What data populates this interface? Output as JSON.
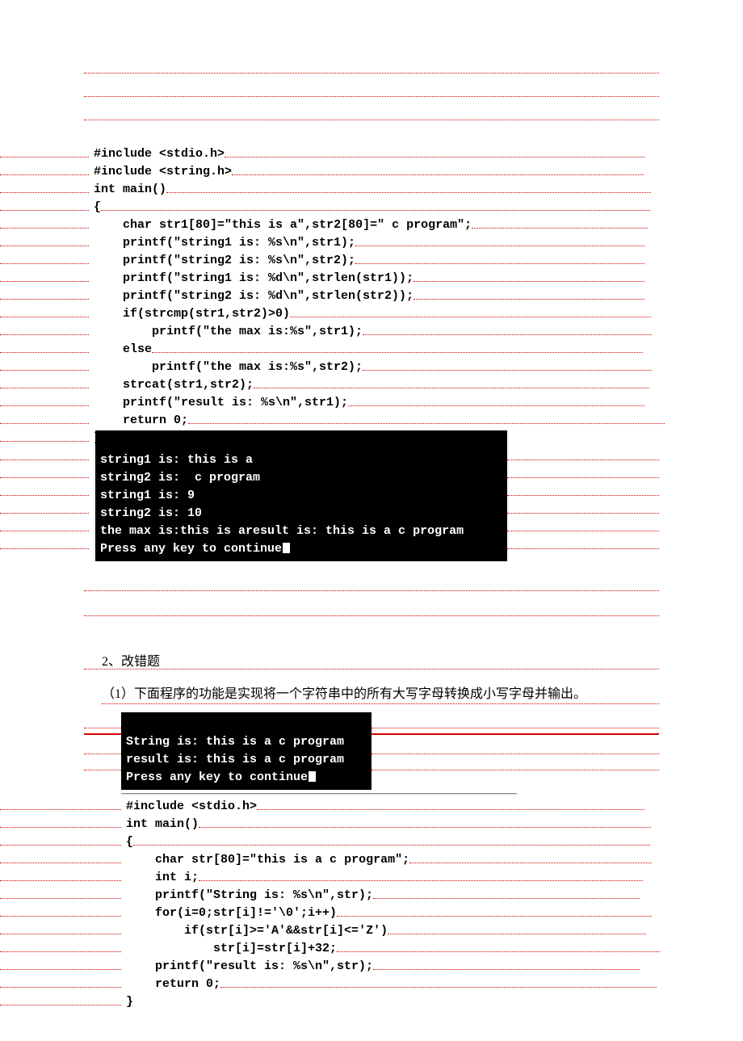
{
  "code1": {
    "la": "#include",
    "lb": "<stdio.h>",
    "lc": "#include",
    "ld": "<string.h>",
    "le": "int",
    "lf": " main()",
    "lg": "{",
    "lh": "char",
    "li": " str1[80]=\"this is a\",str2[80]=\" c program\";",
    "lj": "    printf(\"string1 is: %s\\n\",str1);",
    "lk": "    printf(\"string2 is: %s\\n\",str2);",
    "ll": "    printf(\"string1 is: %d\\n\",strlen(str1));",
    "lm": "    printf(\"string2 is: %d\\n\",strlen(str2));",
    "ln": "if",
    "lo": "(strcmp(str1,str2)>0)",
    "lp": "        printf(\"the max is:%s\",str1);",
    "lq": "else",
    "lr": "        printf(\"the max is:%s\",str2);",
    "ls": "    strcat(str1,str2);",
    "lt": "    printf(\"result is: %s\\n\",str1);",
    "lu": "return",
    "lv": " 0;",
    "lw": "}"
  },
  "console1": {
    "l1": "string1 is: this is a",
    "l2": "string2 is:  c program",
    "l3": "string1 is: 9",
    "l4": "string2 is: 10",
    "l5": "the max is:this is aresult is: this is a c program",
    "l6": "Press any key to continue"
  },
  "section2": {
    "heading": "2、改错题",
    "q1": "（1）下面程序的功能是实现将一个字符串中的所有大写字母转换成小写字母并输出。"
  },
  "console2": {
    "l1": "String is: this is a c program",
    "l2": "result is: this is a c program",
    "l3": "Press any key to continue"
  },
  "code2": {
    "la": "#include",
    "lb": "<stdio.h>",
    "lc": "int",
    "ld": " main()",
    "le": "{",
    "lf": "char",
    "lg": " str[80]=\"this is a c program\";",
    "lh": "int",
    "li": " i;",
    "lj": "    printf(\"String is: %s\\n\",str);",
    "lk": "for",
    "ll": "(i=0;str[i]!='\\0';i++)",
    "lm": "if",
    "ln": "(str[i]>='A'&&str[i]<='Z')",
    "lo": "            str[i]=str[i]+32;",
    "lp": "    printf(\"result is: %s\\n\",str);",
    "lq": "return",
    "lr": " 0;",
    "ls": "}"
  }
}
